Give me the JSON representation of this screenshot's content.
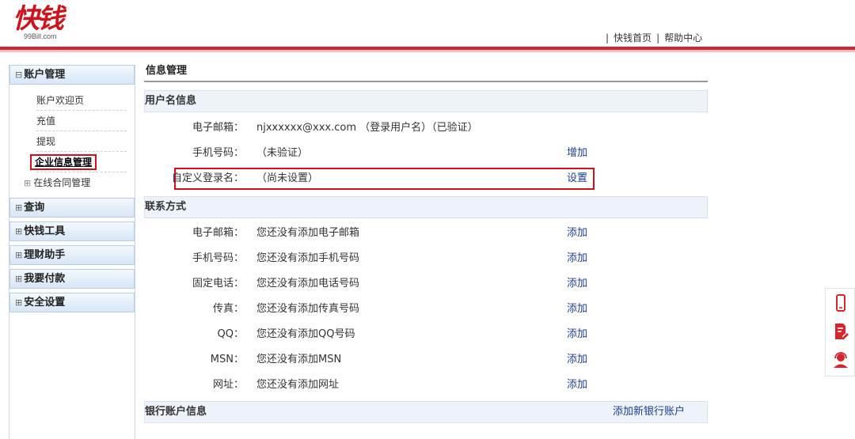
{
  "header": {
    "logo_text": "快钱",
    "logo_sub": "99Bill.com",
    "top_links": [
      "快钱首页",
      "帮助中心"
    ],
    "separator": "|"
  },
  "sidebar": {
    "account_group": {
      "title": "账户管理",
      "items": [
        "账户欢迎页",
        "充值",
        "提现",
        "企业信息管理"
      ],
      "plain_item": "在线合同管理"
    },
    "groups": [
      "查询",
      "快钱工具",
      "理财助手",
      "我要付款",
      "安全设置"
    ],
    "collapse_glyph": "⊟",
    "expand_glyph": "⊞"
  },
  "main": {
    "title": "信息管理",
    "username_section": {
      "title": "用户名信息",
      "rows": [
        {
          "label": "电子邮箱：",
          "value": "njxxxxxx@xxx.com （登录用户名）（已验证）",
          "action": ""
        },
        {
          "label": "手机号码：",
          "value": "（未验证）",
          "action": "增加"
        },
        {
          "label": "自定义登录名：",
          "value": "（尚未设置）",
          "action": "设置"
        }
      ]
    },
    "contact_section": {
      "title": "联系方式",
      "rows": [
        {
          "label": "电子邮箱：",
          "value": "您还没有添加电子邮箱",
          "action": "添加"
        },
        {
          "label": "手机号码：",
          "value": "您还没有添加手机号码",
          "action": "添加"
        },
        {
          "label": "固定电话：",
          "value": "您还没有添加电话号码",
          "action": "添加"
        },
        {
          "label": "传真：",
          "value": "您还没有添加传真号码",
          "action": "添加"
        },
        {
          "label": "QQ：",
          "value": "您还没有添加QQ号码",
          "action": "添加"
        },
        {
          "label": "MSN：",
          "value": "您还没有添加MSN",
          "action": "添加"
        },
        {
          "label": "网址：",
          "value": "您还没有添加网址",
          "action": "添加"
        }
      ]
    },
    "bank_section": {
      "title": "银行账户信息",
      "action": "添加新银行账户"
    }
  },
  "floatbar": {
    "icons": [
      "phone-icon",
      "edit-document-icon",
      "customer-service-icon"
    ]
  },
  "colors": {
    "brand_red": "#d9232d",
    "link_blue": "#1a3e96",
    "highlight_red": "#d20f1a"
  }
}
